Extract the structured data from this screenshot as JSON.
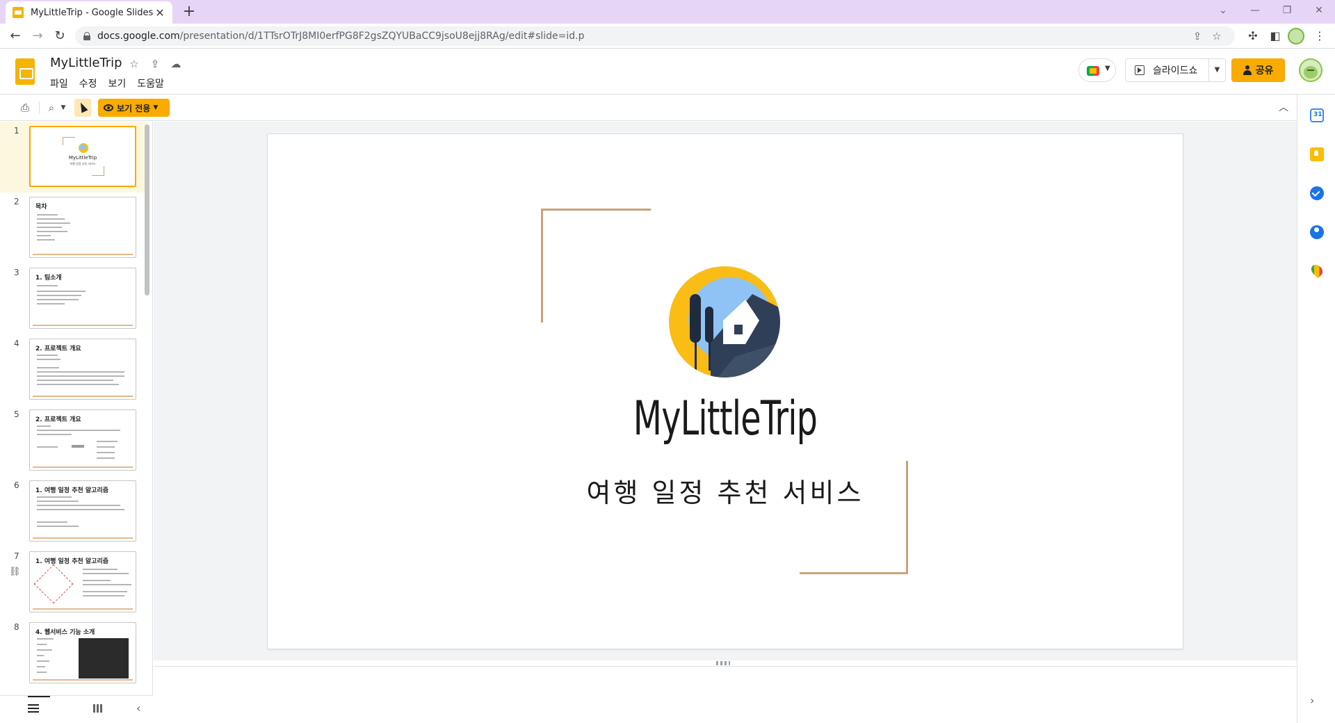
{
  "browser": {
    "tab_title": "MyLittleTrip - Google Slides",
    "tab_close": "✕",
    "new_tab": "+",
    "url_host": "docs.google.com",
    "url_path": "/presentation/d/1TTsrOTrJ8MI0erfPG8F2gsZQYUBaCC9jsoU8ejj8RAg/edit#slide=id.p"
  },
  "header": {
    "doc_title": "MyLittleTrip",
    "menu": [
      "파일",
      "수정",
      "보기",
      "도움말"
    ],
    "slideshow_label": "슬라이드쇼",
    "share_label": "공유"
  },
  "toolbar": {
    "view_only_label": "보기 전용"
  },
  "filmstrip": {
    "slides": [
      {
        "num": "1",
        "heading": ""
      },
      {
        "num": "2",
        "heading": "목차"
      },
      {
        "num": "3",
        "heading": "1. 팀소개"
      },
      {
        "num": "4",
        "heading": "2. 프로젝트 개요"
      },
      {
        "num": "5",
        "heading": "2. 프로젝트 개요"
      },
      {
        "num": "6",
        "heading": "1. 여행 일정 추천 알고리즘"
      },
      {
        "num": "7",
        "heading": "1. 여행 일정 추천 알고리즘"
      },
      {
        "num": "8",
        "heading": "4. 웹서비스 기능 소개"
      }
    ]
  },
  "slide": {
    "title": "MyLittleTrip",
    "subtitle": "여행 일정 추천 서비스"
  },
  "colors": {
    "accent": "#f9ab00",
    "frame": "#c9a27a",
    "tab_strip": "#e7d5f7"
  }
}
